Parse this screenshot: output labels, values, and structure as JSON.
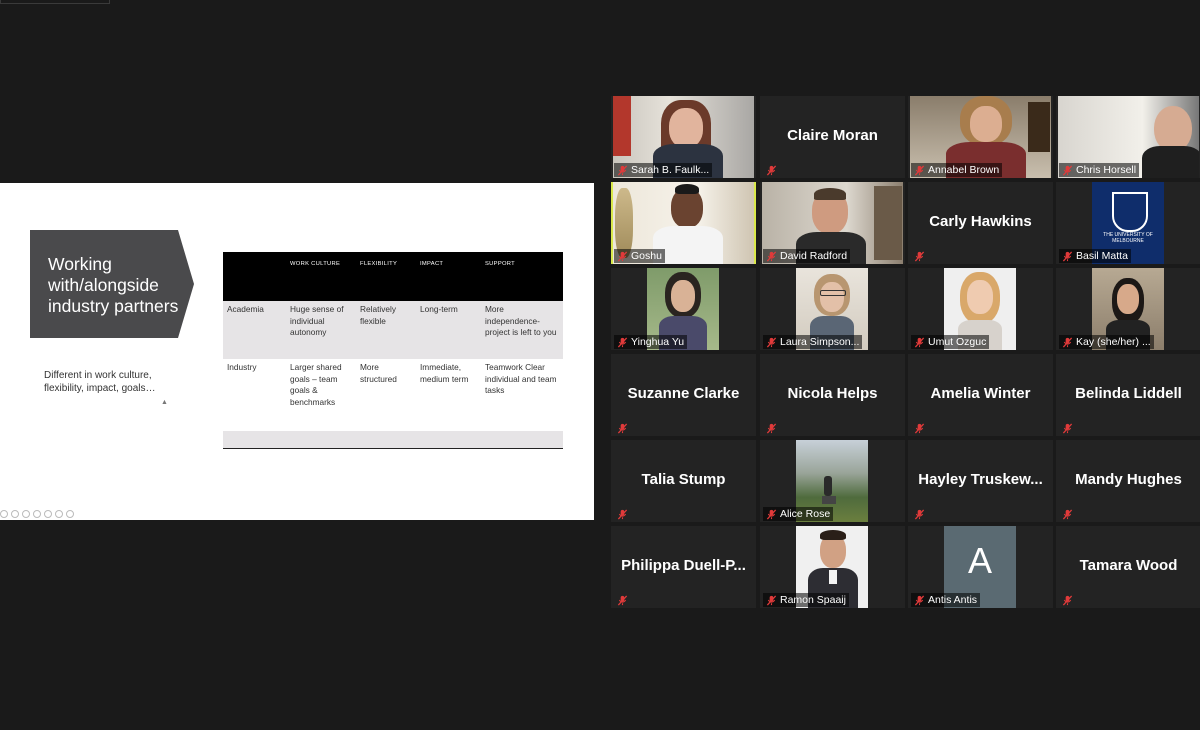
{
  "slide": {
    "title": "Working with/alongside industry partners",
    "subtitle": "Different in work culture, flexibility, impact, goals…",
    "table": {
      "headers": [
        "",
        "WORK CULTURE",
        "FLEXIBILITY",
        "IMPACT",
        "SUPPORT"
      ],
      "rows": [
        [
          "Academia",
          "Huge sense of individual autonomy",
          "Relatively flexible",
          "Long-term",
          "More independence- project is left to you"
        ],
        [
          "Industry",
          "Larger shared goals – team goals & benchmarks",
          "More structured",
          "Immediate, medium term",
          "Teamwork Clear individual and team tasks"
        ]
      ]
    }
  },
  "participants": [
    {
      "name": "Sarah B. Faulk...",
      "video": true,
      "scene": "woman-red-hair",
      "name_center": ""
    },
    {
      "name": "",
      "video": false,
      "name_center": "Claire Moran"
    },
    {
      "name": "Annabel Brown",
      "video": true,
      "scene": "woman-curly"
    },
    {
      "name": "Chris Horsell",
      "video": true,
      "scene": "man-bald"
    },
    {
      "name": "Goshu",
      "video": true,
      "scene": "man-beard-light",
      "active": true
    },
    {
      "name": "David Radford",
      "video": true,
      "scene": "man-room"
    },
    {
      "name": "",
      "video": false,
      "name_center": "Carly Hawkins"
    },
    {
      "name": "Basil Matta",
      "video": true,
      "scene": "unimelb-logo",
      "logo_text": "THE UNIVERSITY OF MELBOURNE"
    },
    {
      "name": "Yinghua Yu",
      "video": true,
      "scene": "woman-dark-hair"
    },
    {
      "name": "Laura Simpson...",
      "video": true,
      "scene": "woman-glasses"
    },
    {
      "name": "Umut Ozguc",
      "video": true,
      "scene": "woman-blonde"
    },
    {
      "name": "Kay (she/her) ...",
      "video": true,
      "scene": "woman-young"
    },
    {
      "name": "",
      "video": false,
      "name_center": "Suzanne Clarke"
    },
    {
      "name": "",
      "video": false,
      "name_center": "Nicola Helps"
    },
    {
      "name": "",
      "video": false,
      "name_center": "Amelia Winter"
    },
    {
      "name": "",
      "video": false,
      "name_center": "Belinda Liddell"
    },
    {
      "name": "",
      "video": false,
      "name_center": "Talia Stump"
    },
    {
      "name": "Alice Rose",
      "video": true,
      "scene": "landscape"
    },
    {
      "name": "",
      "video": false,
      "name_center": "Hayley  Truskew..."
    },
    {
      "name": "",
      "video": false,
      "name_center": "Mandy Hughes"
    },
    {
      "name": "",
      "video": false,
      "name_center": "Philippa  Duell-P..."
    },
    {
      "name": "Ramon Spaaij",
      "video": true,
      "scene": "man-suit"
    },
    {
      "name": "Antis Antis",
      "video": true,
      "scene": "avatar-letter",
      "avatar_letter": "A"
    },
    {
      "name": "",
      "video": false,
      "name_center": "Tamara Wood"
    }
  ],
  "colors": {
    "active_speaker_border": "#d9e84a",
    "mic_muted": "#e03a3a",
    "avatar_bg": "#5a6a72"
  }
}
